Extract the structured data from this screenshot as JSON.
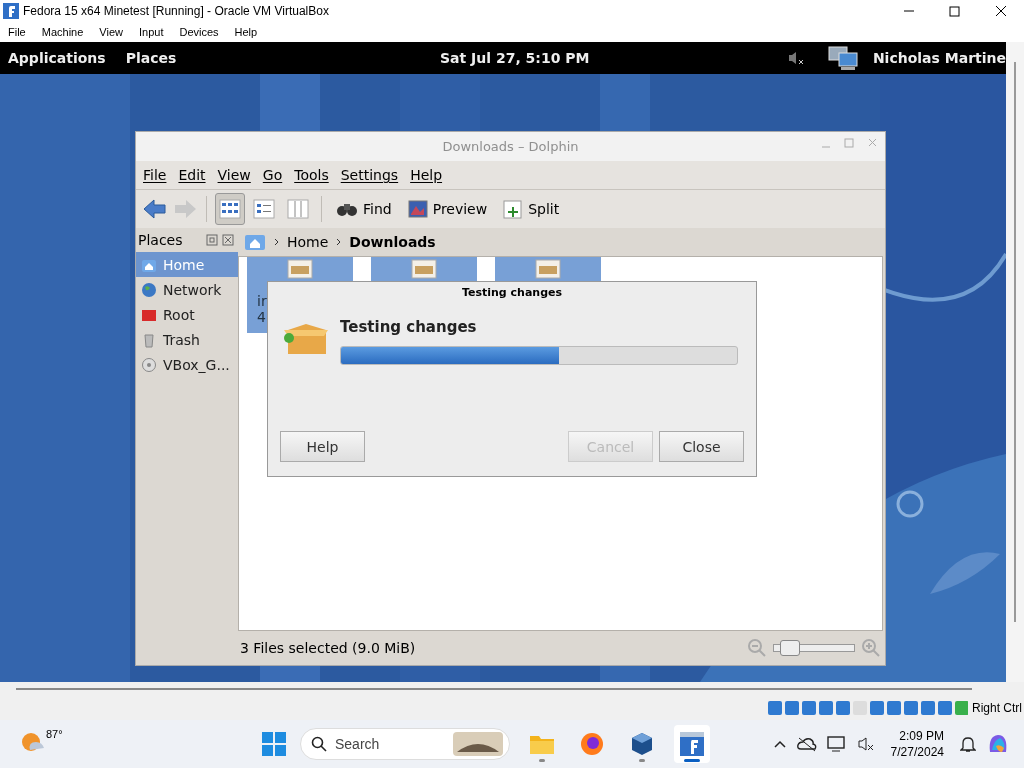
{
  "vm_window": {
    "title": "Fedora 15 x64 Minetest [Running] - Oracle VM VirtualBox",
    "menu": [
      "File",
      "Machine",
      "View",
      "Input",
      "Devices",
      "Help"
    ],
    "host_key": "Right Ctrl"
  },
  "gnome_panel": {
    "menus": [
      "Applications",
      "Places"
    ],
    "clock": "Sat Jul 27, 5:10 PM",
    "user": "Nicholas Martine"
  },
  "dolphin": {
    "title": "Downloads – Dolphin",
    "menu": [
      "File",
      "Edit",
      "View",
      "Go",
      "Tools",
      "Settings",
      "Help"
    ],
    "view_modes": [
      {
        "kind": "icons",
        "selected": true
      },
      {
        "kind": "details",
        "selected": false
      },
      {
        "kind": "columns",
        "selected": false
      }
    ],
    "actions": [
      {
        "kind": "find",
        "label": "Find"
      },
      {
        "kind": "preview",
        "label": "Preview"
      },
      {
        "kind": "split",
        "label": "Split"
      }
    ],
    "places_title": "Places",
    "places": [
      {
        "kind": "home",
        "label": "Home",
        "selected": true
      },
      {
        "kind": "network",
        "label": "Network",
        "selected": false
      },
      {
        "kind": "root",
        "label": "Root",
        "selected": false
      },
      {
        "kind": "trash",
        "label": "Trash",
        "selected": false
      },
      {
        "kind": "drive",
        "label": "VBox_G...",
        "selected": false
      }
    ],
    "breadcrumb": [
      {
        "label": "Home",
        "current": false
      },
      {
        "label": "Downloads",
        "current": true
      }
    ],
    "files": [
      {
        "selected": true,
        "lines": [
          "ir",
          "4"
        ]
      },
      {
        "selected": true
      },
      {
        "selected": true
      }
    ],
    "status": "3 Files selected (9.0 MiB)",
    "zoom": {
      "level": 0.1
    }
  },
  "dialog": {
    "title": "Testing changes",
    "heading": "Testing changes",
    "progress": {
      "level": 0.55
    },
    "buttons": [
      {
        "label": "Help",
        "disabled": false
      },
      {
        "label": "Cancel",
        "disabled": true
      },
      {
        "label": "Close",
        "disabled": false
      }
    ]
  },
  "taskbar": {
    "weather": "87°",
    "search_placeholder": "Search",
    "apps": [
      {
        "kind": "files",
        "running": true,
        "selected": false
      },
      {
        "kind": "firefox",
        "running": false,
        "selected": false
      },
      {
        "kind": "virtualbox",
        "running": true,
        "selected": false
      },
      {
        "kind": "vm",
        "running": true,
        "selected": true
      }
    ],
    "time": "2:09 PM",
    "date": "7/27/2024"
  }
}
